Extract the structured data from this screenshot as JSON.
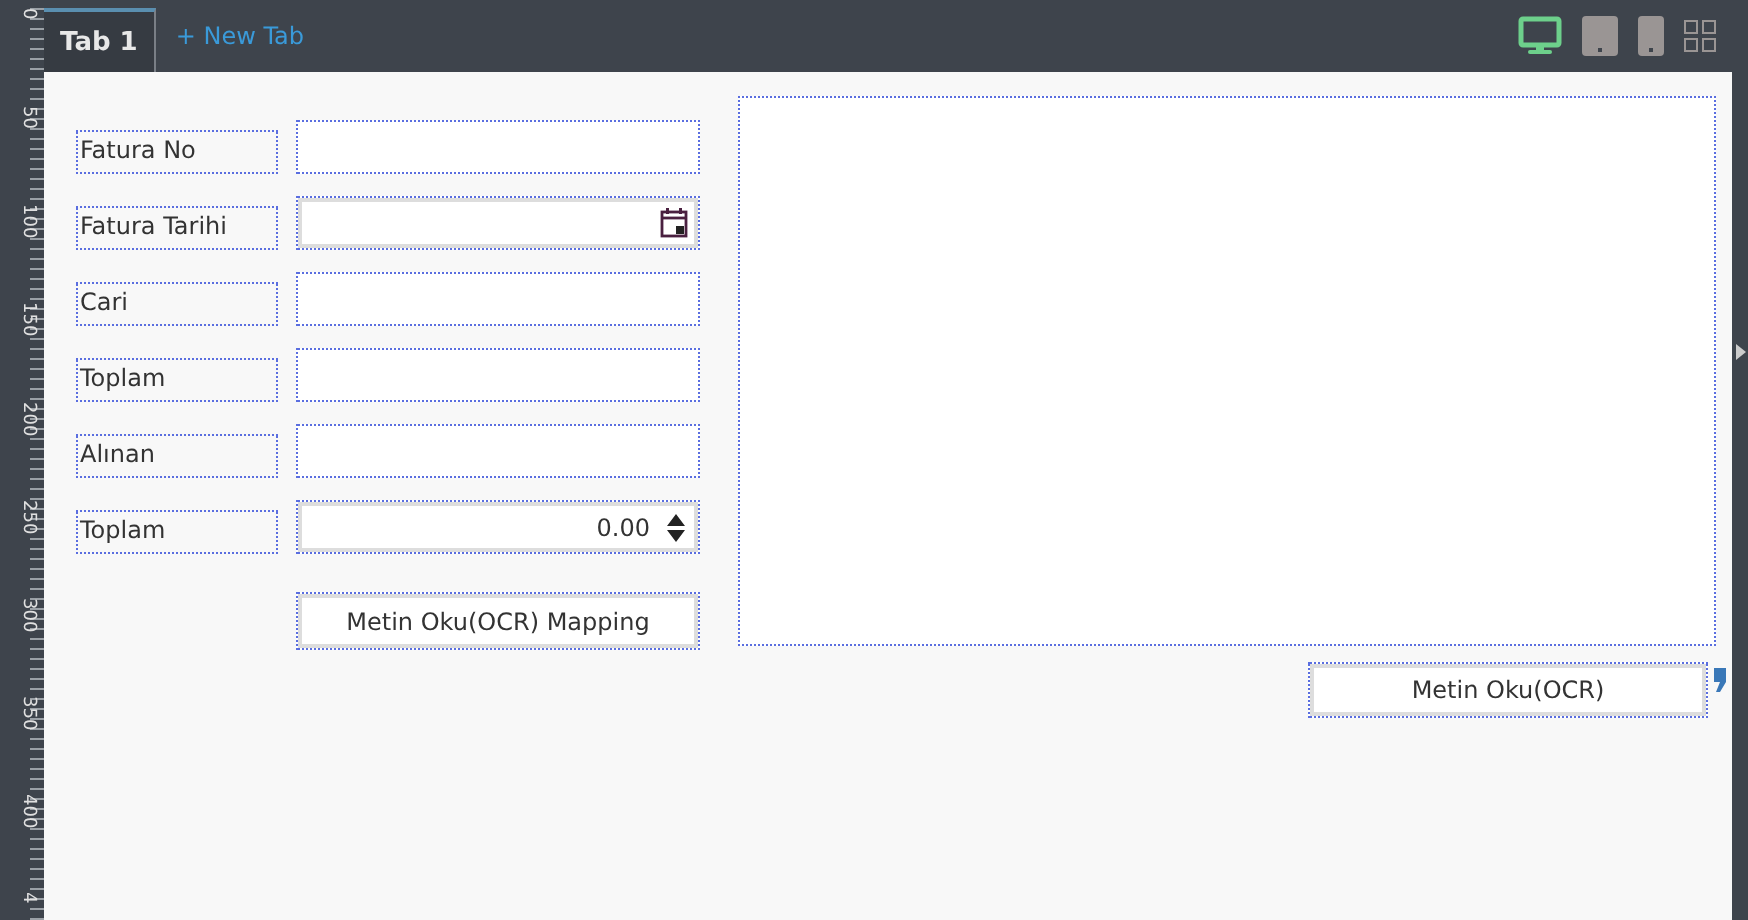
{
  "tabs": [
    {
      "label": "Tab 1",
      "selected": true
    }
  ],
  "new_tab": "+ New Tab",
  "devices": [
    {
      "kind": "desktop",
      "selected": true
    },
    {
      "kind": "tablet",
      "selected": false
    },
    {
      "kind": "phone",
      "selected": false
    },
    {
      "kind": "grid",
      "selected": false
    }
  ],
  "ruler": [
    "0",
    "50",
    "100",
    "150",
    "200",
    "250",
    "300",
    "350",
    "400",
    "4"
  ],
  "form": [
    {
      "label": "Fatura No",
      "kind": "text"
    },
    {
      "label": "Fatura Tarihi",
      "kind": "date"
    },
    {
      "label": "Cari",
      "kind": "text"
    },
    {
      "label": "Toplam",
      "kind": "text"
    },
    {
      "label": "Alınan",
      "kind": "text"
    },
    {
      "label": "Toplam",
      "kind": "number",
      "value": "0.00"
    }
  ],
  "mapping_button": "Metin Oku(OCR) Mapping",
  "ocr_button": "Metin Oku(OCR)"
}
